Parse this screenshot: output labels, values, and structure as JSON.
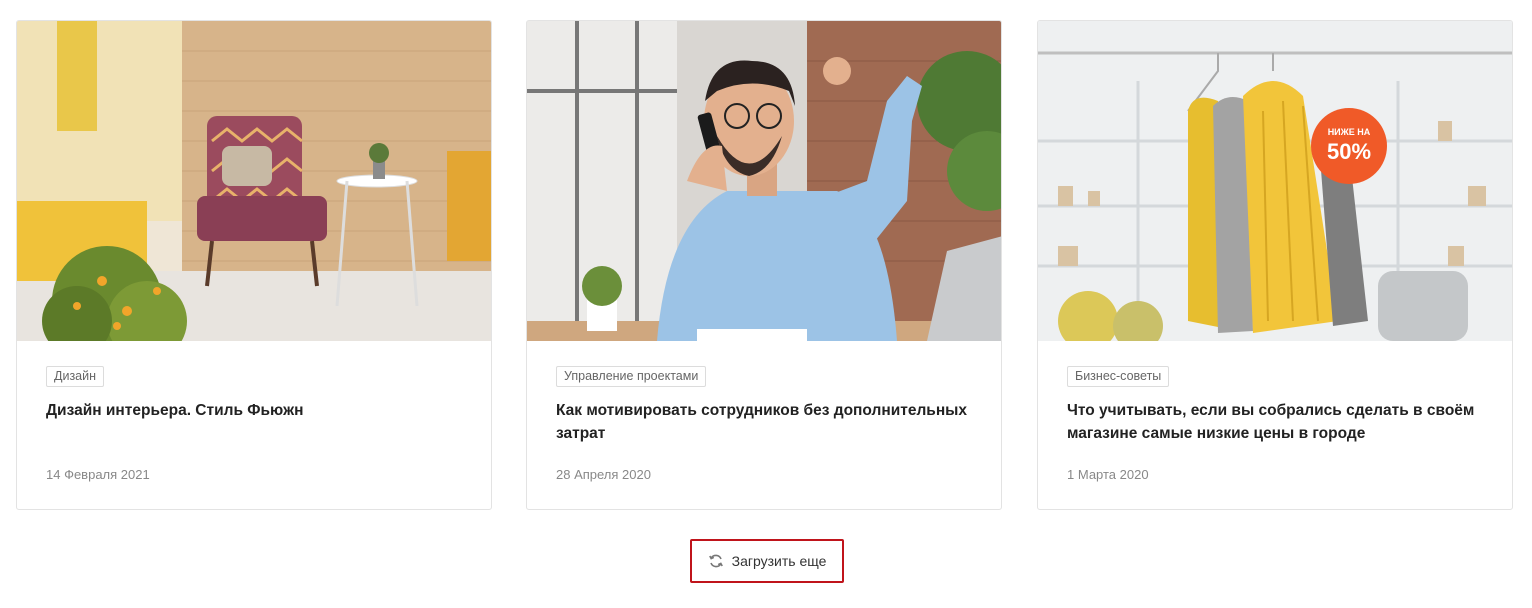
{
  "posts": [
    {
      "category": "Дизайн",
      "title": "Дизайн интерьера. Стиль Фьюжн",
      "date": "14 Февраля 2021",
      "image": "interior-armchair-photo"
    },
    {
      "category": "Управление проектами",
      "title": "Как мотивировать сотрудников без дополнительных затрат",
      "date": "28 Апреля 2020",
      "image": "man-on-phone-celebrating-photo"
    },
    {
      "category": "Бизнес-советы",
      "title": "Что учитывать, если вы собрались сделать в своём магазине самые низкие цены в городе",
      "date": "1 Марта 2020",
      "image": "clothing-rack-sale-photo",
      "badge_top": "НИЖЕ НА",
      "badge_value": "50%"
    }
  ],
  "load_more": {
    "label": "Загрузить еще",
    "icon": "refresh-icon"
  },
  "colors": {
    "accent_border": "#c0141b",
    "badge_orange": "#f05a28"
  }
}
